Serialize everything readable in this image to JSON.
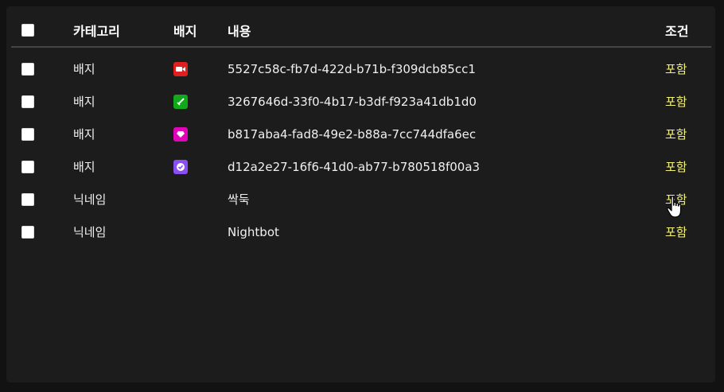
{
  "header": {
    "category": "카테고리",
    "badge": "배지",
    "content": "내용",
    "condition": "조건"
  },
  "rows": [
    {
      "category": "배지",
      "badge_icon": "video-badge-icon",
      "badge_color": "#e02020",
      "content": "5527c58c-fb7d-422d-b71b-f309dcb85cc1",
      "condition": "포함"
    },
    {
      "category": "배지",
      "badge_icon": "sword-badge-icon",
      "badge_color": "#11a81c",
      "content": "3267646d-33f0-4b17-b3df-f923a41db1d0",
      "condition": "포함"
    },
    {
      "category": "배지",
      "badge_icon": "gem-badge-icon",
      "badge_color": "#e005b9",
      "content": "b817aba4-fad8-49e2-b88a-7cc744dfa6ec",
      "condition": "포함"
    },
    {
      "category": "배지",
      "badge_icon": "verified-badge-icon",
      "badge_color": "#8b4ef2",
      "content": "d12a2e27-16f6-41d0-ab77-b780518f00a3",
      "condition": "포함"
    },
    {
      "category": "닉네임",
      "badge_icon": "",
      "badge_color": "",
      "content": "싹둑",
      "condition": "포함"
    },
    {
      "category": "닉네임",
      "badge_icon": "",
      "badge_color": "",
      "content": "Nightbot",
      "condition": "포함"
    }
  ],
  "colors": {
    "background": "#1c1c1c",
    "condition_text": "#f3f37a"
  }
}
